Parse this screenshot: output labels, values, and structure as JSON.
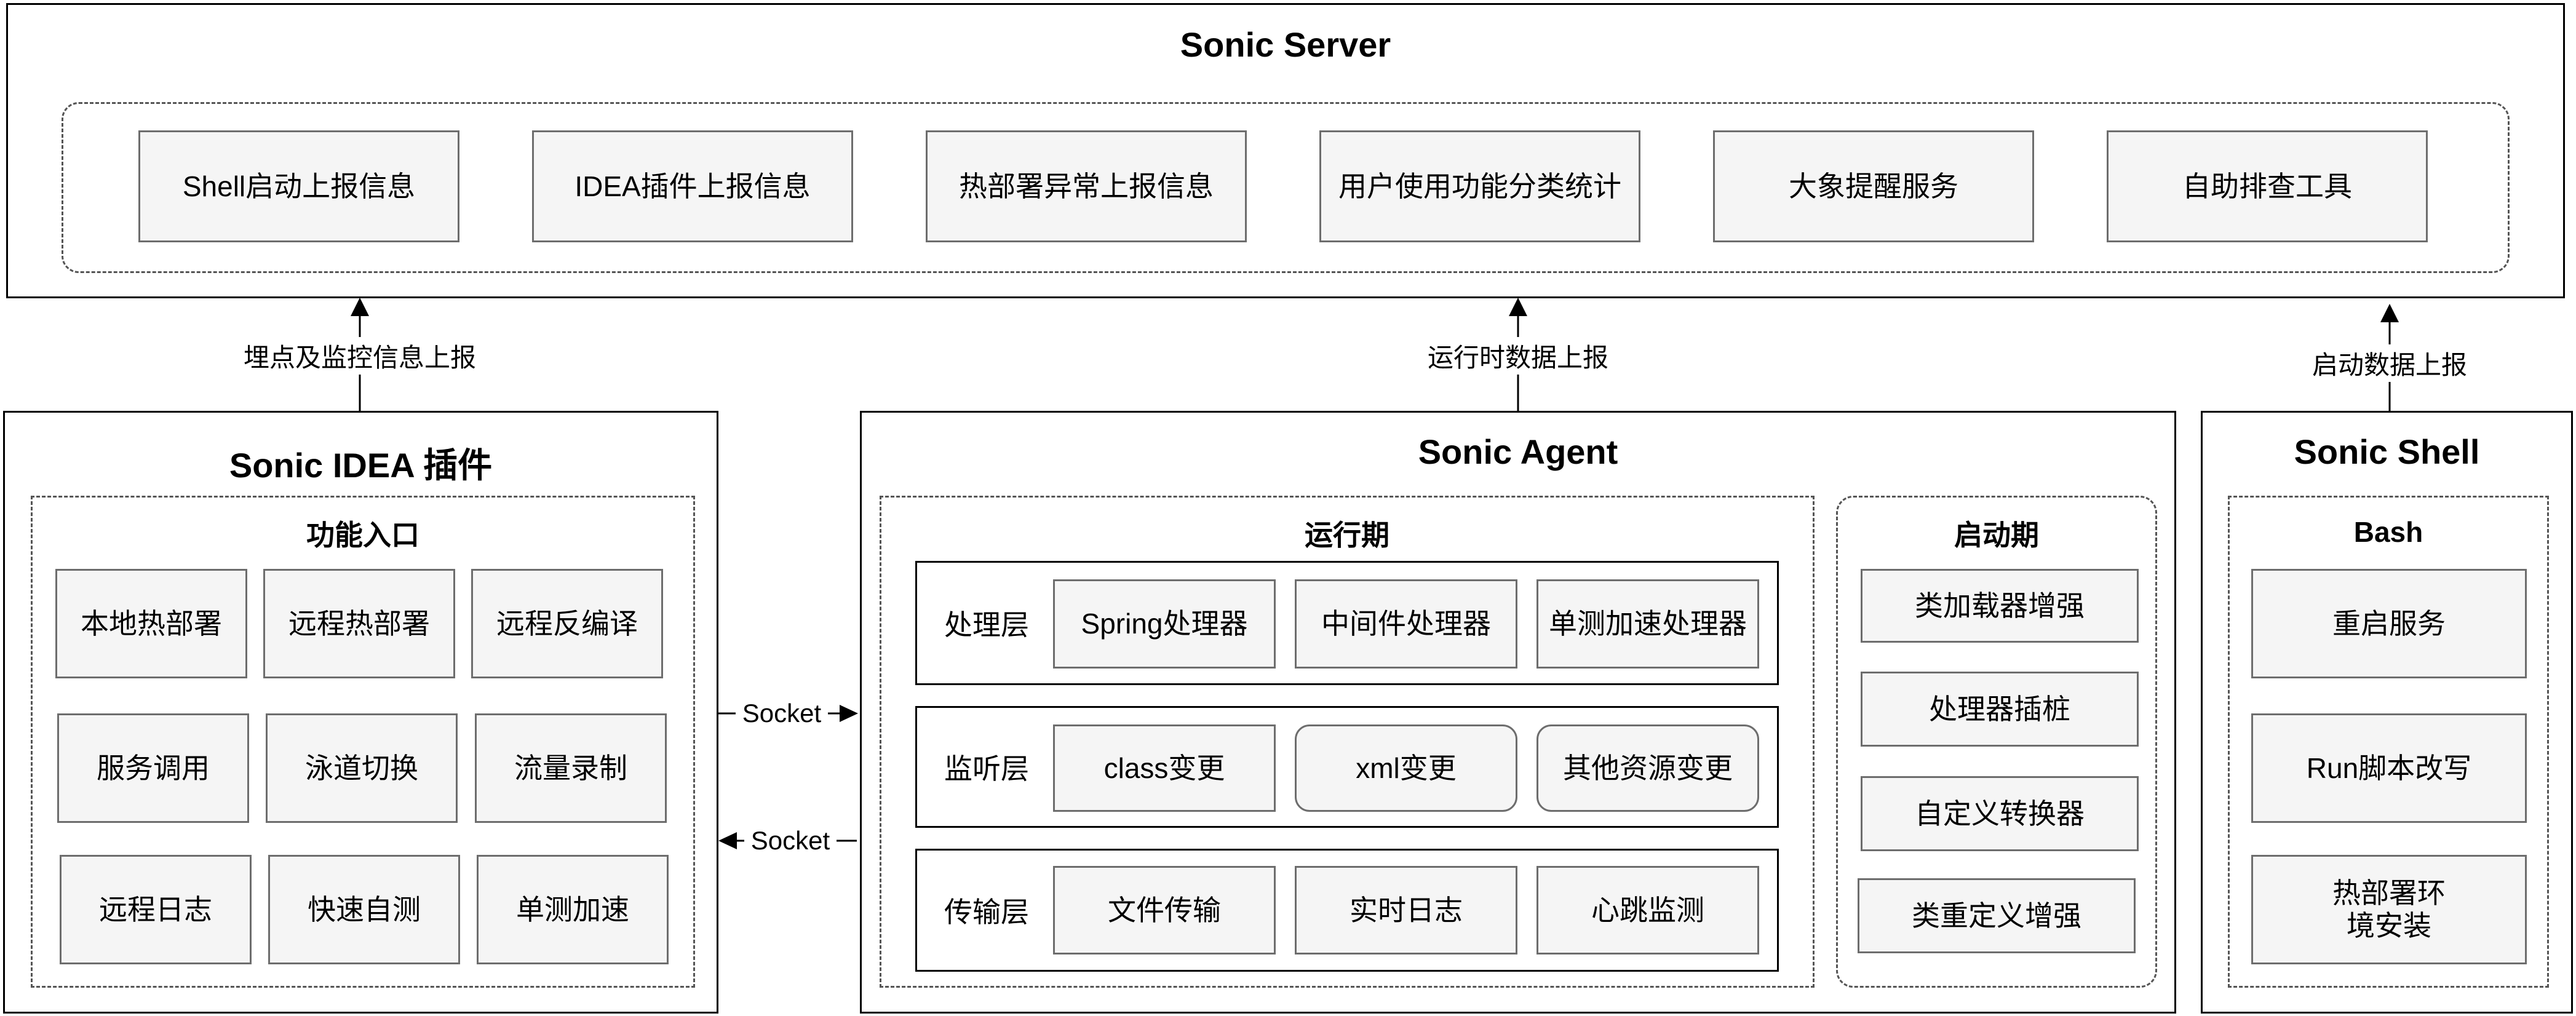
{
  "server": {
    "title": "Sonic Server",
    "items": [
      "Shell启动上报信息",
      "IDEA插件上报信息",
      "热部署异常上报信息",
      "用户使用功能分类统计",
      "大象提醒服务",
      "自助排查工具"
    ]
  },
  "idea": {
    "title": "Sonic IDEA 插件",
    "group_title": "功能入口",
    "items": [
      "本地热部署",
      "远程热部署",
      "远程反编译",
      "服务调用",
      "泳道切换",
      "流量录制",
      "远程日志",
      "快速自测",
      "单测加速"
    ]
  },
  "agent": {
    "title": "Sonic Agent",
    "runtime": {
      "title": "运行期",
      "layers": [
        {
          "label": "处理层",
          "items": [
            "Spring处理器",
            "中间件处理器",
            "单测加速处理器"
          ]
        },
        {
          "label": "监听层",
          "items": [
            "class变更",
            "xml变更",
            "其他资源变更"
          ]
        },
        {
          "label": "传输层",
          "items": [
            "文件传输",
            "实时日志",
            "心跳监测"
          ]
        }
      ]
    },
    "startup": {
      "title": "启动期",
      "items": [
        "类加载器增强",
        "处理器插桩",
        "自定义转换器",
        "类重定义增强"
      ]
    }
  },
  "shell": {
    "title": "Sonic Shell",
    "group_title": "Bash",
    "items": [
      "重启服务",
      "Run脚本改写",
      "热部署环境安装"
    ]
  },
  "edges": {
    "idea_to_server": "埋点及监控信息上报",
    "agent_to_server": "运行时数据上报",
    "shell_to_server": "启动数据上报",
    "socket_right": "Socket",
    "socket_left": "Socket"
  }
}
